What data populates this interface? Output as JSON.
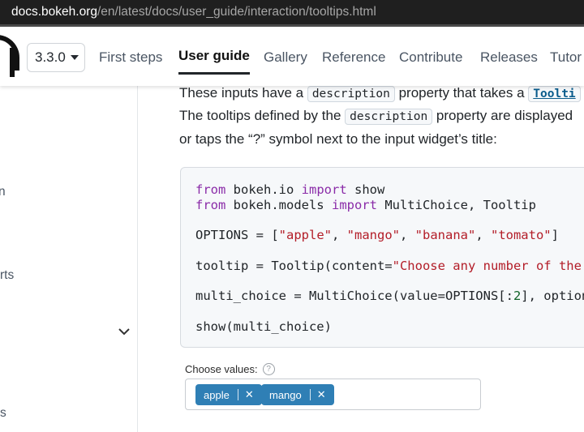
{
  "browser": {
    "url_host": "docs.bokeh.org",
    "url_path": "/en/latest/docs/user_guide/interaction/tooltips.html"
  },
  "header": {
    "version": "3.3.0",
    "nav": [
      {
        "label": "First steps"
      },
      {
        "label": "User guide"
      },
      {
        "label": "Gallery"
      },
      {
        "label": "Reference"
      },
      {
        "label": "Contribute"
      },
      {
        "label": "Releases"
      },
      {
        "label": "Tutor"
      }
    ]
  },
  "sidebar": {
    "fragments": [
      "n",
      "rts",
      "s"
    ]
  },
  "content": {
    "p1a": "These inputs have a ",
    "p1code": "description",
    "p1b": " property that takes a ",
    "p1code2": "Toolti",
    "p2a": "The tooltips defined by the ",
    "p2code": "description",
    "p2b": " property are displayed",
    "p3": "or taps the “?” symbol next to the input widget’s title:"
  },
  "code": {
    "l1_kw1": "from",
    "l1_mod": " bokeh.io ",
    "l1_kw2": "import",
    "l1_name": " show",
    "l2_kw1": "from",
    "l2_mod": " bokeh.models ",
    "l2_kw2": "import",
    "l2_name": " MultiChoice, Tooltip",
    "l3_a": "OPTIONS = [",
    "l3_s1": "\"apple\"",
    "l3_c1": ", ",
    "l3_s2": "\"mango\"",
    "l3_c2": ", ",
    "l3_s3": "\"banana\"",
    "l3_c3": ", ",
    "l3_s4": "\"tomato\"",
    "l3_b": "]",
    "l4_a": "tooltip = Tooltip(content=",
    "l4_s": "\"Choose any number of the i",
    "l5_a": "multi_choice = MultiChoice(value=OPTIONS[:",
    "l5_n": "2",
    "l5_b": "], options=",
    "l6": "show(multi_choice)"
  },
  "widget": {
    "label": "Choose values:",
    "help": "?",
    "chips": [
      {
        "label": "apple",
        "close": "✕"
      },
      {
        "label": "mango",
        "close": "✕"
      }
    ]
  },
  "icons": {
    "sidebar_toggle": "chevron-down-icon",
    "remove": "close-icon",
    "help": "help-circle-icon"
  }
}
